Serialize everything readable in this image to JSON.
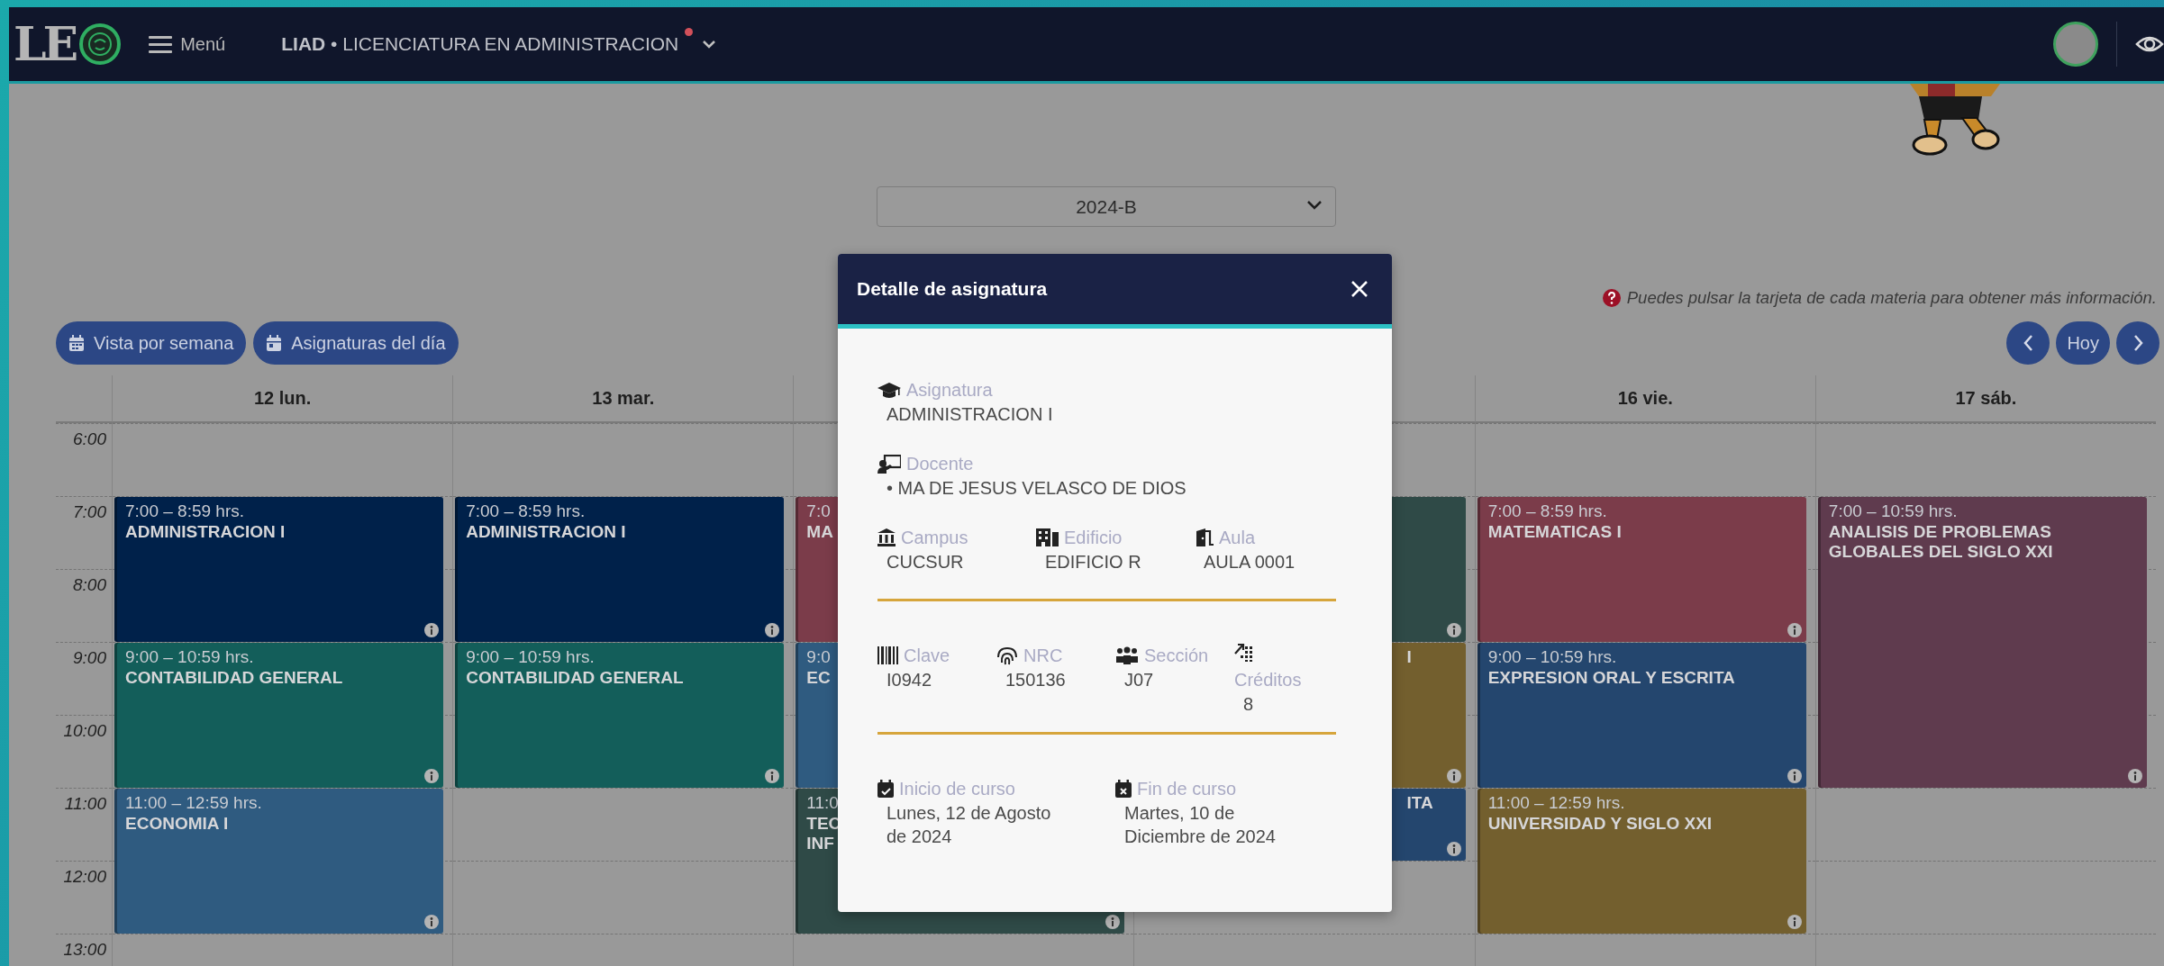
{
  "navbar": {
    "logo_text": "LE",
    "menu_label": "Menú",
    "program": "**LIAD** • LICENCIATURA EN ADMINISTRACION",
    "notification": true
  },
  "period_select": {
    "value": "2024-B"
  },
  "hint": "Puedes pulsar la tarjeta de cada materia para obtener más información.",
  "view_buttons": [
    {
      "kind": "week",
      "label": "Vista por semana"
    },
    {
      "kind": "day",
      "label": "Asignaturas del día"
    }
  ],
  "nav": {
    "today": "Hoy"
  },
  "calendar": {
    "hours": [
      "6:00",
      "7:00",
      "8:00",
      "9:00",
      "10:00",
      "11:00",
      "12:00",
      "13:00"
    ],
    "days": [
      {
        "label": "12 lun.",
        "events": [
          {
            "kind": "double",
            "time": "7:00 – 8:59 hrs.",
            "title": "ADMINISTRACION I",
            "color": "#00214a"
          },
          {
            "kind": "double",
            "time": "9:00 – 10:59 hrs.",
            "title": "CONTABILIDAD GENERAL",
            "color": "#135e5a"
          },
          {
            "kind": "double",
            "time": "11:00 – 12:59 hrs.",
            "title": "ECONOMIA I",
            "color": "#2f5b80"
          }
        ]
      },
      {
        "label": "13 mar.",
        "events": [
          {
            "kind": "double",
            "time": "7:00 – 8:59 hrs.",
            "title": "ADMINISTRACION I",
            "color": "#00214a"
          },
          {
            "kind": "double",
            "time": "9:00 – 10:59 hrs.",
            "title": "CONTABILIDAD GENERAL",
            "color": "#135e5a"
          }
        ]
      },
      {
        "events": [
          {
            "kind": "double",
            "time": "7:0",
            "title": "MA",
            "color": "#7b3c4a"
          },
          {
            "kind": "double",
            "time": "9:0",
            "title": "EC",
            "color": "#2f5b80"
          },
          {
            "kind": "double",
            "time": "11:0",
            "title": "TEC\nINF",
            "color": "#2f4a47"
          }
        ]
      },
      {
        "events": [
          {
            "kind": "double",
            "color": "#2f4a47"
          },
          {
            "kind": "double",
            "title": "I",
            "color": "#735f2e"
          },
          {
            "kind": "single",
            "title": "ITA",
            "color": "#24466e"
          }
        ]
      },
      {
        "label": "16 vie.",
        "events": [
          {
            "kind": "double",
            "time": "7:00 – 8:59 hrs.",
            "title": "MATEMATICAS I",
            "color": "#7b3c4a"
          },
          {
            "kind": "double",
            "time": "9:00 – 10:59 hrs.",
            "title": "EXPRESION ORAL Y ESCRITA",
            "color": "#24466e"
          },
          {
            "kind": "double",
            "time": "11:00 – 12:59 hrs.",
            "title": "UNIVERSIDAD Y SIGLO XXI",
            "color": "#735f2e"
          }
        ]
      },
      {
        "label": "17 sáb.",
        "events": [
          {
            "kind": "quadruple",
            "time": "7:00 – 10:59 hrs.",
            "title": "ANALISIS DE PROBLEMAS GLOBALES DEL SIGLO XXI",
            "color": "#5f3b4e"
          }
        ]
      }
    ]
  },
  "modal": {
    "title": "Detalle de asignatura",
    "rows": [
      {
        "kind": "fields",
        "fields": [
          {
            "kind": "asignatura",
            "label": "Asignatura",
            "value": "ADMINISTRACION I"
          }
        ]
      },
      {
        "kind": "fields",
        "fields": [
          {
            "kind": "docente",
            "label": "Docente",
            "value": "• MA DE JESUS VELASCO DE DIOS"
          }
        ]
      },
      {
        "kind": "fields",
        "fields": [
          {
            "kind": "campus",
            "label": "Campus",
            "value": "CUCSUR"
          },
          {
            "kind": "edificio",
            "label": "Edificio",
            "value": "EDIFICIO R"
          },
          {
            "kind": "aula",
            "label": "Aula",
            "value": "AULA 0001"
          }
        ]
      },
      {
        "kind": "divider"
      },
      {
        "kind": "fields",
        "fields": [
          {
            "kind": "clave",
            "label": "Clave",
            "value": "I0942"
          },
          {
            "kind": "nrc",
            "label": "NRC",
            "value": "150136"
          },
          {
            "kind": "seccion",
            "label": "Sección",
            "value": "J07"
          },
          {
            "kind": "creditos",
            "label": "Créditos",
            "value": "8"
          }
        ]
      },
      {
        "kind": "divider"
      },
      {
        "kind": "fields",
        "fields": [
          {
            "kind": "inicio",
            "label": "Inicio de curso",
            "value": "Lunes, 12 de Agosto de 2024"
          },
          {
            "kind": "fin",
            "label": "Fin de curso",
            "value": "Martes, 10 de Diciembre de 2024"
          }
        ]
      }
    ]
  }
}
